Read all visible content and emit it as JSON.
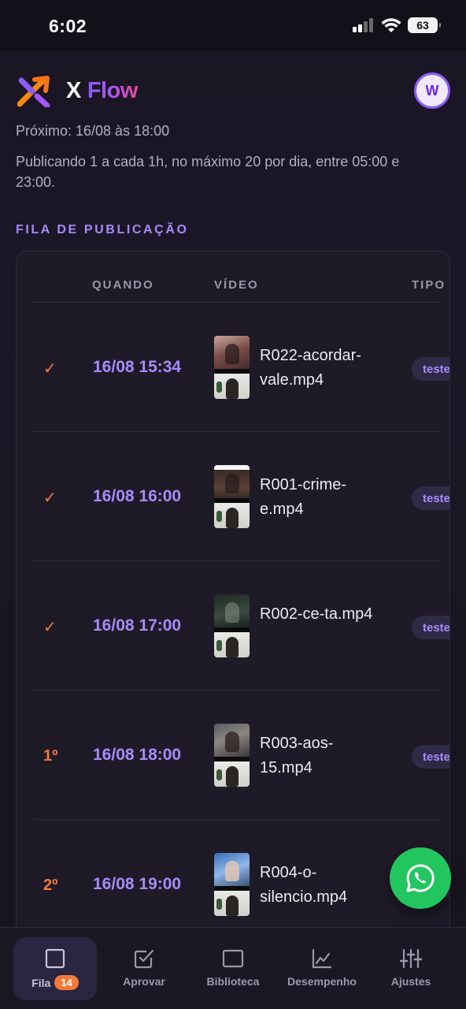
{
  "status_bar": {
    "time": "6:02",
    "battery": "63"
  },
  "header": {
    "brand_x": "X",
    "brand_flow": "Flow",
    "avatar_initial": "W"
  },
  "schedule": {
    "next": "Próximo: 16/08 às 18:00",
    "rule": "Publicando 1 a cada 1h, no máximo 20 por dia, entre 05:00 e 23:00."
  },
  "queue": {
    "title": "FILA DE PUBLICAÇÃO",
    "columns": {
      "when": "QUANDO",
      "video": "VÍDEO",
      "type": "TIPO"
    },
    "rows": [
      {
        "status": "✓",
        "when": "16/08 15:34",
        "file": "R022-acordar-vale.mp4",
        "type": "teste"
      },
      {
        "status": "✓",
        "when": "16/08 16:00",
        "file": "R001-crime-e.mp4",
        "type": "teste"
      },
      {
        "status": "✓",
        "when": "16/08 17:00",
        "file": "R002-ce-ta.mp4",
        "type": "teste"
      },
      {
        "status": "1º",
        "when": "16/08 18:00",
        "file": "R003-aos-15.mp4",
        "type": "teste"
      },
      {
        "status": "2º",
        "when": "16/08 19:00",
        "file": "R004-o-silencio.mp4",
        "type": "teste"
      }
    ]
  },
  "bottom_nav": {
    "items": [
      {
        "label": "Fila",
        "badge": "14",
        "icon": "square-icon"
      },
      {
        "label": "Aprovar",
        "icon": "check-square-icon"
      },
      {
        "label": "Biblioteca",
        "icon": "square-icon"
      },
      {
        "label": "Desempenho",
        "icon": "line-chart-icon"
      },
      {
        "label": "Ajustes",
        "icon": "sliders-icon"
      }
    ]
  },
  "colors": {
    "accent": "#a78bfa",
    "orange": "#f47a3a",
    "whatsapp": "#22c55e"
  }
}
